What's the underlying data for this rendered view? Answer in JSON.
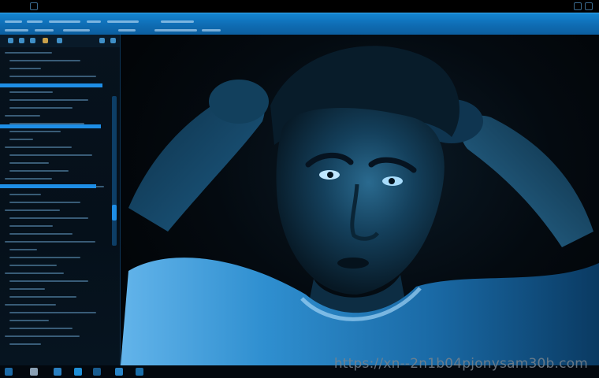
{
  "watermark": {
    "text": "https://xn--2n1b04pjonysam30b.com"
  },
  "colors": {
    "menu_band": "#1486d2",
    "panel_bg": "#07121d",
    "highlight_line": "#1e8ee6",
    "skin_shadow": "#0b2a3f",
    "shirt": "#2f8fd0"
  },
  "icons": [
    "window-control-icon",
    "toolbar-icon",
    "taskbar-app-icon"
  ]
}
